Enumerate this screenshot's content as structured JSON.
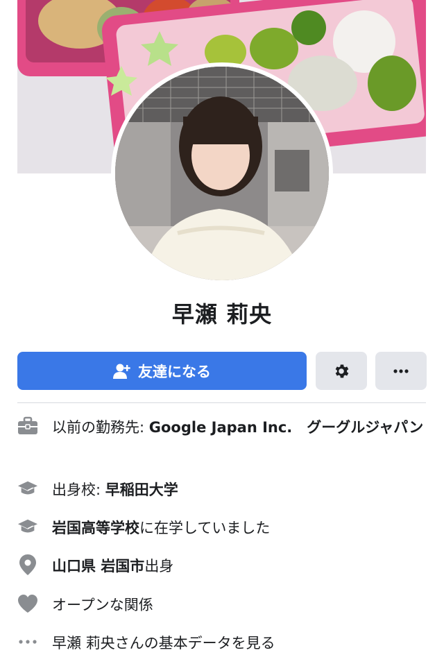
{
  "profile": {
    "name": "早瀬 莉央"
  },
  "actions": {
    "add_friend_label": "友達になる"
  },
  "info": {
    "work": {
      "prefix": "以前の勤務先: ",
      "value": "Google Japan Inc.　グーグルジャパン"
    },
    "education": {
      "prefix": "出身校: ",
      "value": "早稲田大学"
    },
    "highschool": {
      "value": "岩国高等学校",
      "suffix": "に在学していました"
    },
    "hometown": {
      "pref": "山口県",
      "city": "岩国市",
      "suffix": "出身"
    },
    "relationship": {
      "value": "オープンな関係"
    },
    "about": {
      "value": "早瀬 莉央さんの基本データを見る"
    }
  },
  "colors": {
    "primary": "#3a78e7",
    "icon_gray": "#8a8d91",
    "button_gray": "#e4e6eb"
  }
}
